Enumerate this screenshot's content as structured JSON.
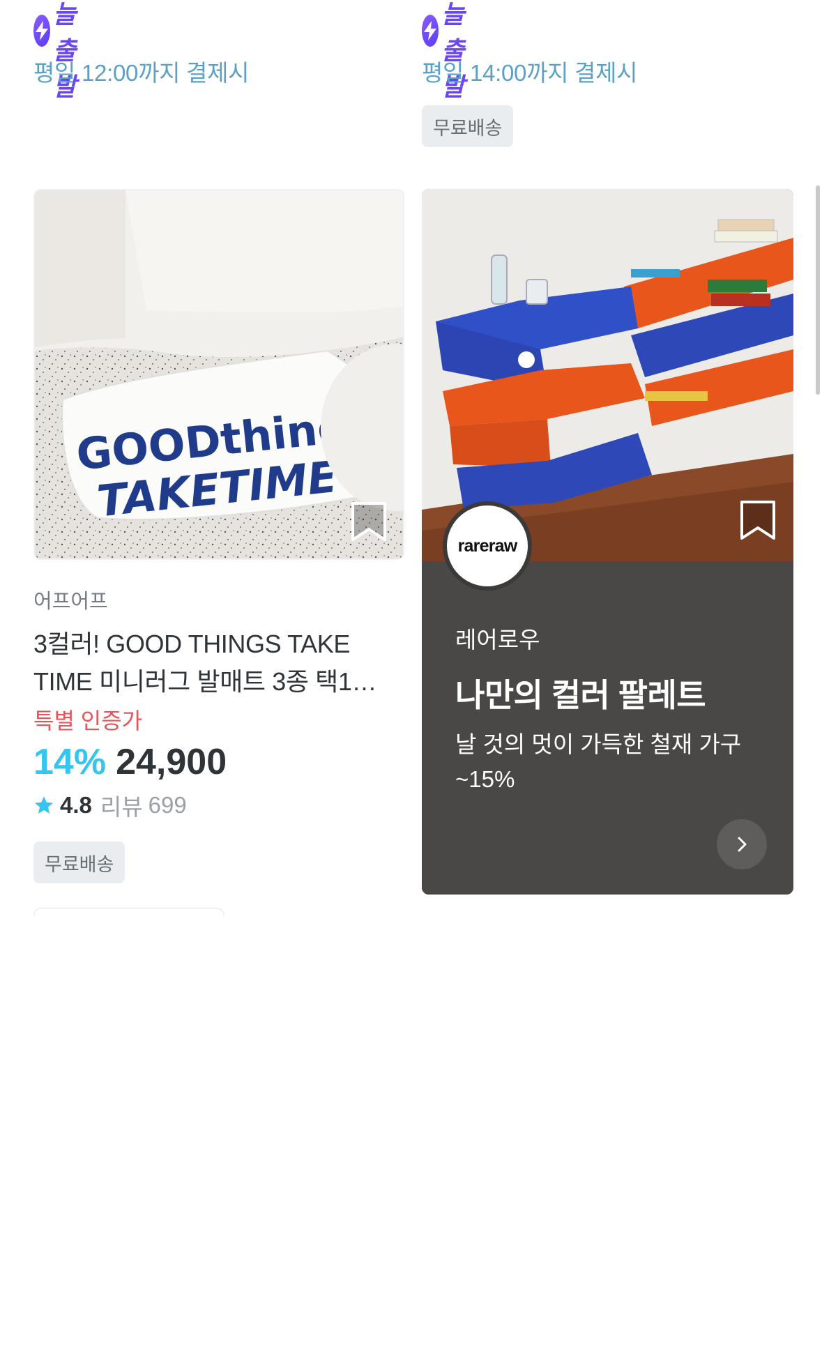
{
  "top_left": {
    "today_label": "오늘출발",
    "deadline": "평일 12:00까지 결제시"
  },
  "top_right": {
    "today_label": "오늘출발",
    "deadline": "평일 14:00까지 결제시",
    "badge": "무료배송"
  },
  "product": {
    "brand": "어프어프",
    "name": "3컬러! GOOD THINGS TAKE TIME 미니러그 발매트 3종 택1…",
    "special": "특별 인증가",
    "discount": "14%",
    "price": "24,900",
    "rating": "4.8",
    "review_label": "리뷰",
    "review_count": "699",
    "badge": "무료배송",
    "rug_text_line1": "GOODthings",
    "rug_text_line2": "TAKETIME"
  },
  "promo": {
    "logo_text": "rareraw",
    "brand": "레어로우",
    "title": "나만의 컬러 팔레트",
    "description": "날 것의 멋이 가득한 철재 가구 ~15%"
  },
  "colors": {
    "accent_blue": "#35c5f0",
    "today_purple": "#6a45f2",
    "special_red": "#e4555a",
    "promo_bg": "#4a4846"
  }
}
